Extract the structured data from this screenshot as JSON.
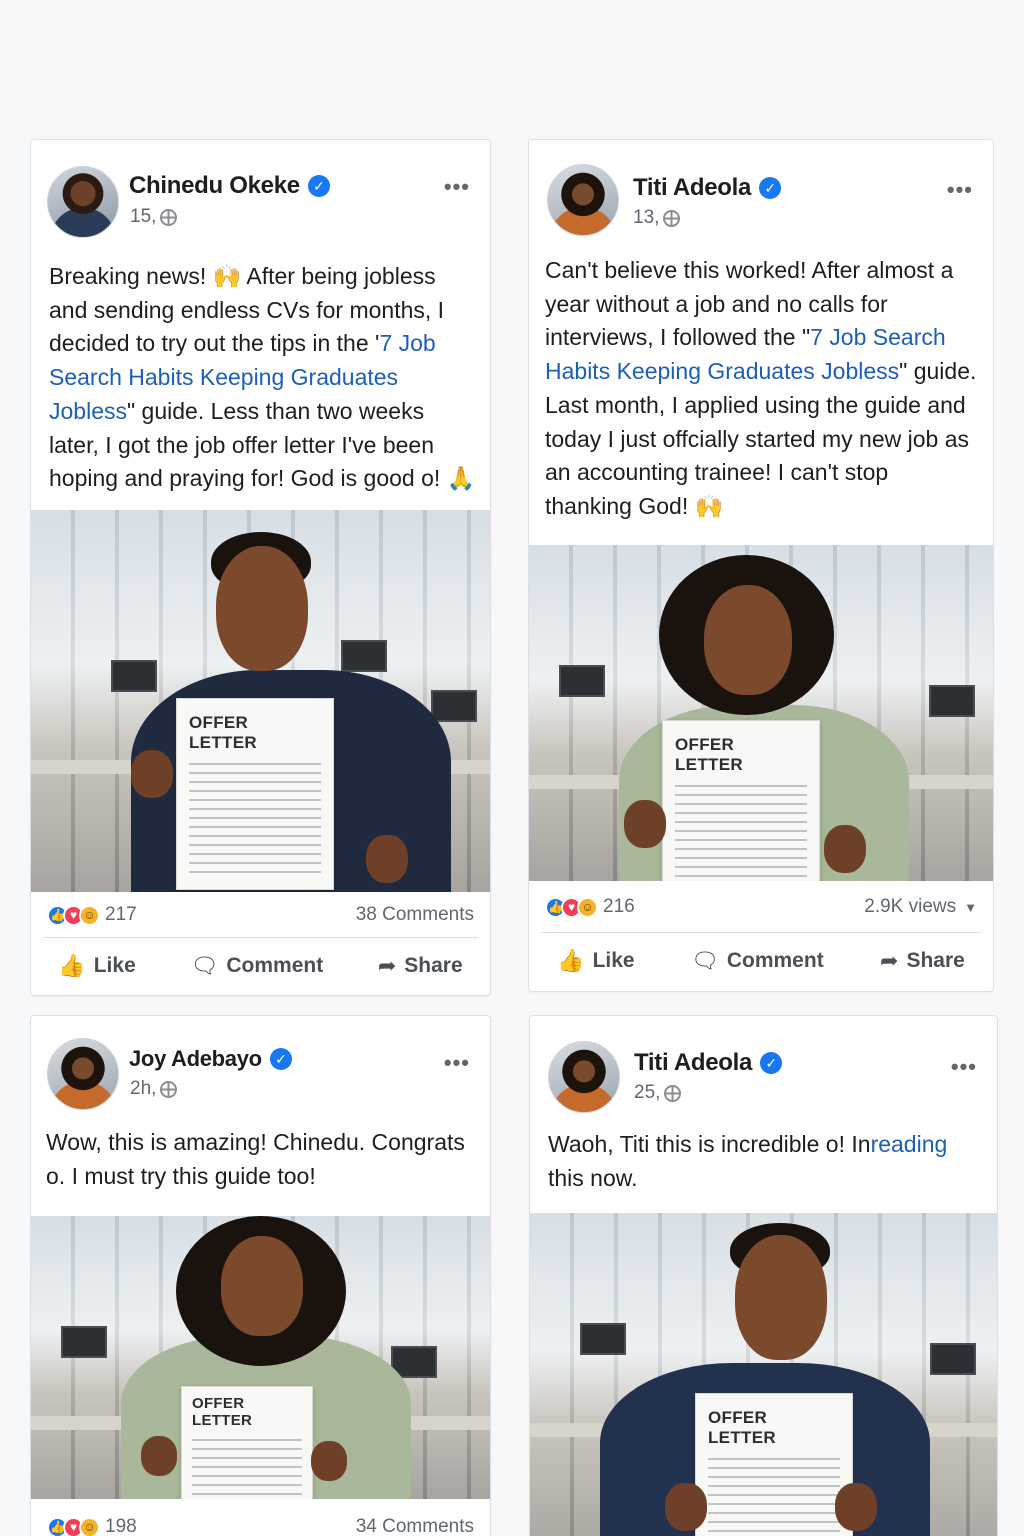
{
  "posts": [
    {
      "author": "Chinedu Okeke",
      "time": "15⁠,",
      "text_before": "Breaking news! 🙌 After being jobless and sending endless CVs for months, I decided to try out the tips in the '",
      "link": "7 Job Search Habits Keeping Graduates Jobless",
      "text_after": "\" guide. Less than two weeks later, I got the job offer letter I've been hoping and praying for! God is good o! 🙏",
      "letter_title": "OFFER LETTER",
      "reaction_count": "217",
      "right_stat": "38 Comments"
    },
    {
      "author": "Titi Adeola",
      "time": "13⁠,",
      "text_before": "Can't believe this worked! After almost a year without a job and no calls for interviews, I followed the \"",
      "link": "7 Job Search Habits Keeping Graduates Jobless",
      "text_after": "\" guide. Last month, I applied using the guide and today I just offcially started my new job as an accounting trainee! I can't stop thanking God! 🙌",
      "letter_title": "OFFER LETTER",
      "reaction_count": "216",
      "right_stat": "2.9K views"
    },
    {
      "author": "Joy Adebayo",
      "time": "2h⁠,",
      "text_before": "Wow, this is amazing! Chinedu. Congrats o. I must try this guide too!",
      "link": "",
      "text_after": "",
      "letter_title": "OFFER LETTER",
      "reaction_count": "198",
      "right_stat": "34 Comments"
    },
    {
      "author": "Titi Adeola",
      "time": "25⁠,",
      "text_before": "Waoh, Titi this is incredible o! In",
      "link": "reading",
      "text_after": " this now.",
      "letter_title": "OFFER LETTER",
      "reaction_count": "",
      "right_stat": ""
    }
  ],
  "actions": {
    "like": "Like",
    "comment": "Comment",
    "share": "Share"
  },
  "icons": {
    "more": "more-options-icon",
    "verified": "verified-badge-icon",
    "globe": "globe-icon"
  },
  "colors": {
    "accent": "#1877f2",
    "link": "#1b5fb8",
    "love": "#f33e58",
    "haha": "#f7b125"
  }
}
